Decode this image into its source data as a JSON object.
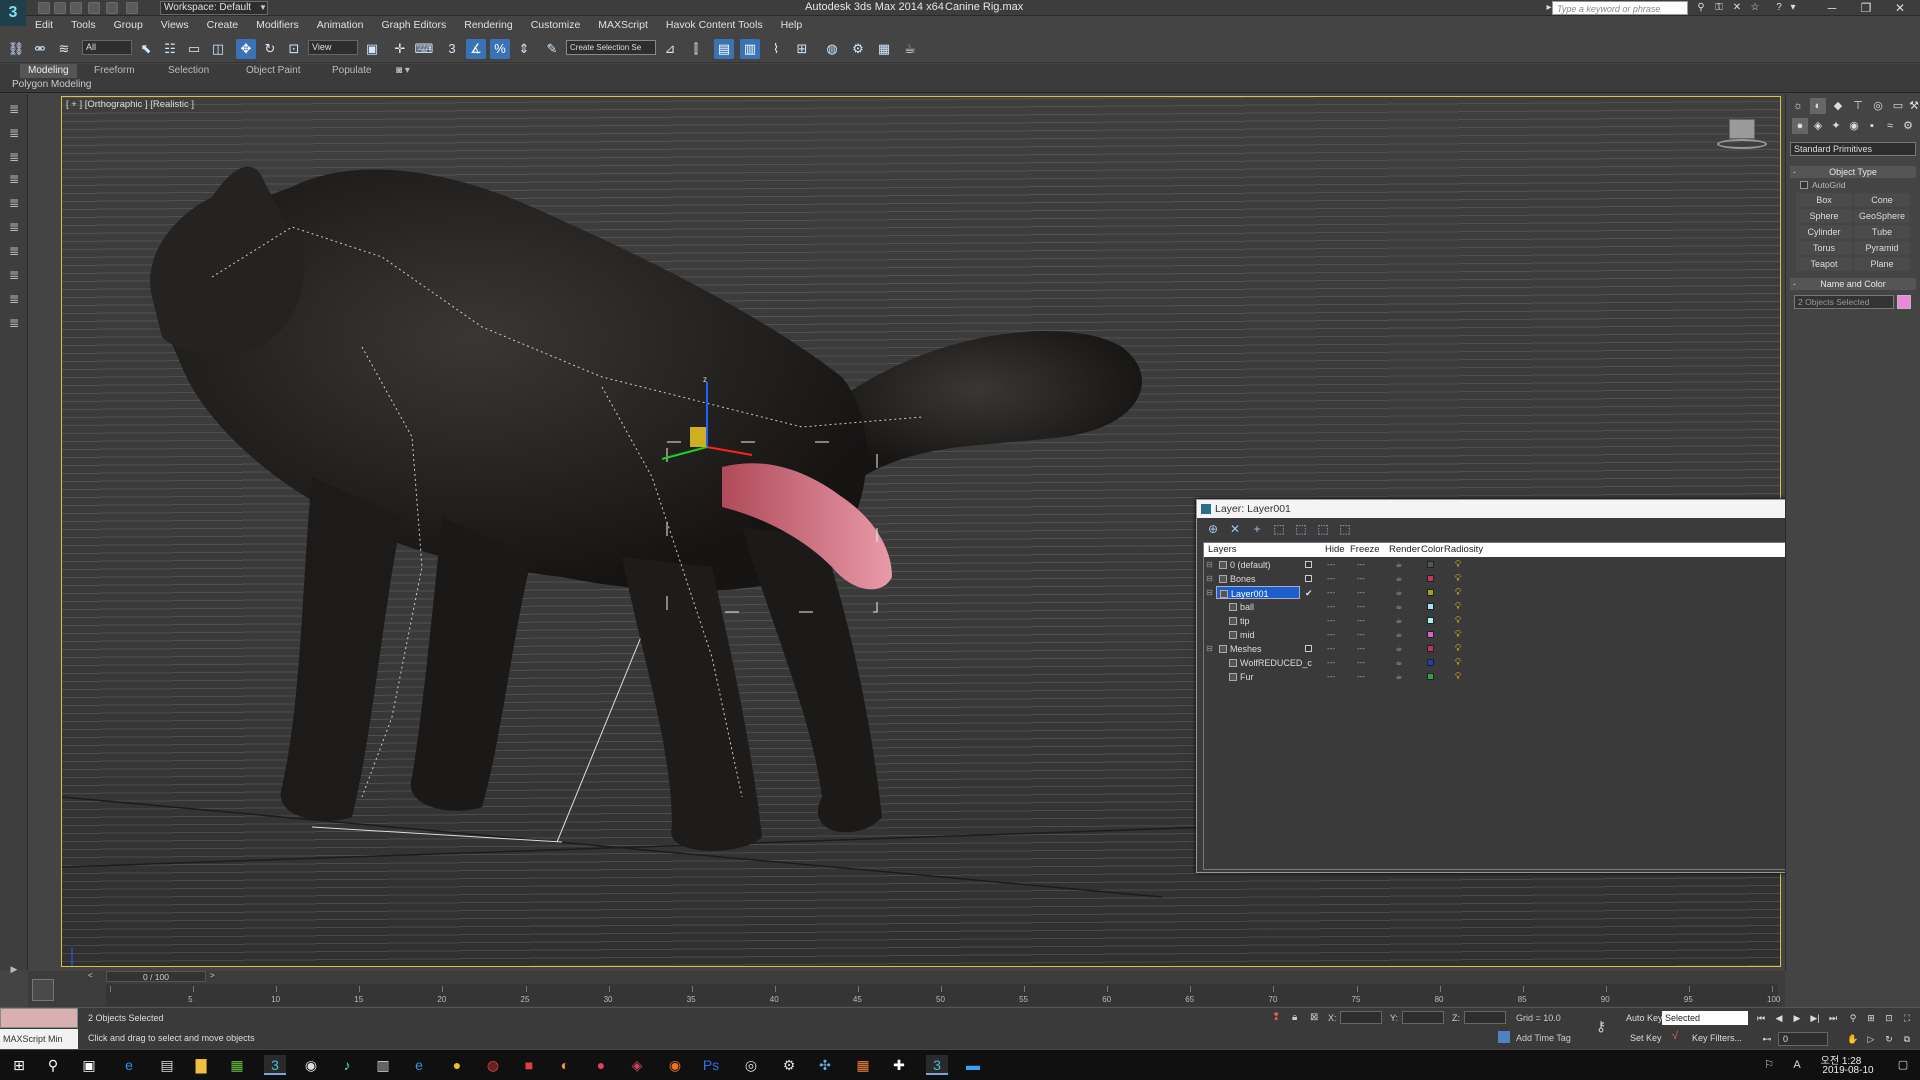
{
  "titlebar": {
    "workspace": "Workspace: Default",
    "app_title": "Autodesk 3ds Max  2014 x64",
    "file_title": "Canine Rig.max",
    "search_placeholder": "Type a keyword or phrase"
  },
  "menu": [
    "Edit",
    "Tools",
    "Group",
    "Views",
    "Create",
    "Modifiers",
    "Animation",
    "Graph Editors",
    "Rendering",
    "Customize",
    "MAXScript",
    "Havok Content Tools",
    "Help"
  ],
  "toolbar": {
    "selection_filter": "All",
    "ref_coord": "View",
    "selection_set": "Create Selection Se"
  },
  "ribbon": {
    "tabs": [
      "Modeling",
      "Freeform",
      "Selection",
      "Object Paint",
      "Populate"
    ],
    "active_tab": "Modeling",
    "panel_label": "Polygon Modeling"
  },
  "viewport": {
    "label": "[ + ] [Orthographic ] [Realistic ]"
  },
  "layer_dialog": {
    "title": "Layer: Layer001",
    "columns": [
      "Layers",
      "Hide",
      "Freeze",
      "Render",
      "Color",
      "Radiosity"
    ],
    "rows": [
      {
        "name": "0 (default)",
        "child": false,
        "color": "#555555",
        "checkbox": true,
        "current": false,
        "selected": false
      },
      {
        "name": "Bones",
        "child": false,
        "color": "#c0385a",
        "checkbox": true,
        "current": false,
        "selected": false
      },
      {
        "name": "Layer001",
        "child": false,
        "color": "#a0a020",
        "checkbox": false,
        "current": true,
        "selected": true
      },
      {
        "name": "ball",
        "child": true,
        "color": "#a8e0f8",
        "checkbox": false,
        "current": false,
        "selected": false
      },
      {
        "name": "tip",
        "child": true,
        "color": "#a8f0f0",
        "checkbox": false,
        "current": false,
        "selected": false
      },
      {
        "name": "mid",
        "child": true,
        "color": "#e060c0",
        "checkbox": false,
        "current": false,
        "selected": false
      },
      {
        "name": "Meshes",
        "child": false,
        "color": "#c03060",
        "checkbox": true,
        "current": false,
        "selected": false
      },
      {
        "name": "WolfREDUCED_c",
        "child": true,
        "color": "#2040b0",
        "checkbox": false,
        "current": false,
        "selected": false
      },
      {
        "name": "Fur",
        "child": true,
        "color": "#30a040",
        "checkbox": false,
        "current": false,
        "selected": false
      }
    ]
  },
  "command_panel": {
    "dropdown": "Standard Primitives",
    "object_type_title": "Object Type",
    "autogrid": "AutoGrid",
    "primitives": [
      "Box",
      "Cone",
      "Sphere",
      "GeoSphere",
      "Cylinder",
      "Tube",
      "Torus",
      "Pyramid",
      "Teapot",
      "Plane"
    ],
    "name_color_title": "Name and Color",
    "name_field": "2 Objects Selected",
    "name_color": "#e88ad8"
  },
  "timeline": {
    "slider": "0 / 100",
    "ticks": [
      "5",
      "10",
      "15",
      "20",
      "25",
      "30",
      "35",
      "40",
      "45",
      "50",
      "55",
      "60",
      "65",
      "70",
      "75",
      "80",
      "85",
      "90",
      "95",
      "100"
    ]
  },
  "status": {
    "maxscript_label": "MAXScript Min",
    "objects_selected": "2 Objects Selected",
    "prompt": "Click and drag to select and move objects",
    "x_label": "X:",
    "y_label": "Y:",
    "z_label": "Z:",
    "grid": "Grid = 10.0",
    "add_time_tag": "Add Time Tag",
    "auto_key": "Auto Key",
    "key_mode": "Selected",
    "set_key": "Set Key",
    "key_filters": "Key Filters...",
    "frame": "0"
  },
  "taskbar": {
    "time": "오전 1:28",
    "date": "2019-08-10"
  }
}
